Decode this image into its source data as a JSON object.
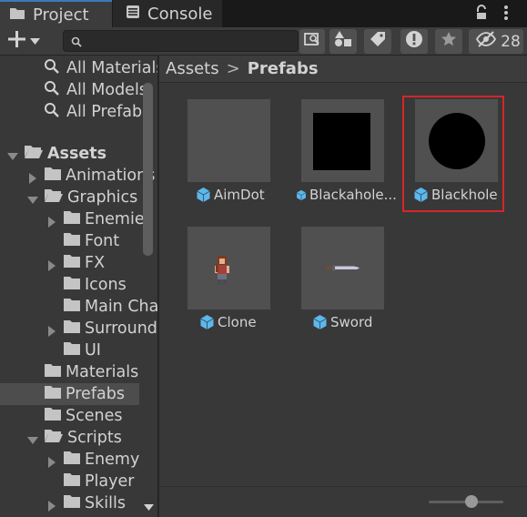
{
  "tabs": [
    {
      "label": "Project",
      "icon": "folder-icon"
    },
    {
      "label": "Console",
      "icon": "console-icon"
    }
  ],
  "toolbar": {
    "hidden_count": "28"
  },
  "favorites": [
    {
      "label": "All Materials"
    },
    {
      "label": "All Models"
    },
    {
      "label": "All Prefabs"
    }
  ],
  "tree": {
    "assets": "Assets",
    "animations": "Animations",
    "graphics": "Graphics",
    "enemies": "Enemies",
    "font": "Font",
    "fx": "FX",
    "icons": "Icons",
    "main_character": "Main Character",
    "surroundings": "Surroundings",
    "ui": "UI",
    "materials": "Materials",
    "prefabs": "Prefabs",
    "scenes": "Scenes",
    "scripts": "Scripts",
    "enemy": "Enemy",
    "player": "Player",
    "skills": "Skills"
  },
  "breadcrumb": {
    "root": "Assets",
    "separator": ">",
    "current": "Prefabs"
  },
  "assets": [
    {
      "name": "AimDot",
      "thumb": "empty"
    },
    {
      "name": "Blackaholе...",
      "thumb": "black-square"
    },
    {
      "name": "Blackhole",
      "thumb": "black-circle",
      "selected": true
    },
    {
      "name": "Clone",
      "thumb": "character-sprite"
    },
    {
      "name": "Sword",
      "thumb": "sword-sprite"
    }
  ],
  "colors": {
    "selection_outline": "#d6252b",
    "prefab_icon": "#5fb7ea",
    "active_tab_accent": "#3a79bb"
  },
  "zoom_slider": {
    "value": 0.55
  }
}
